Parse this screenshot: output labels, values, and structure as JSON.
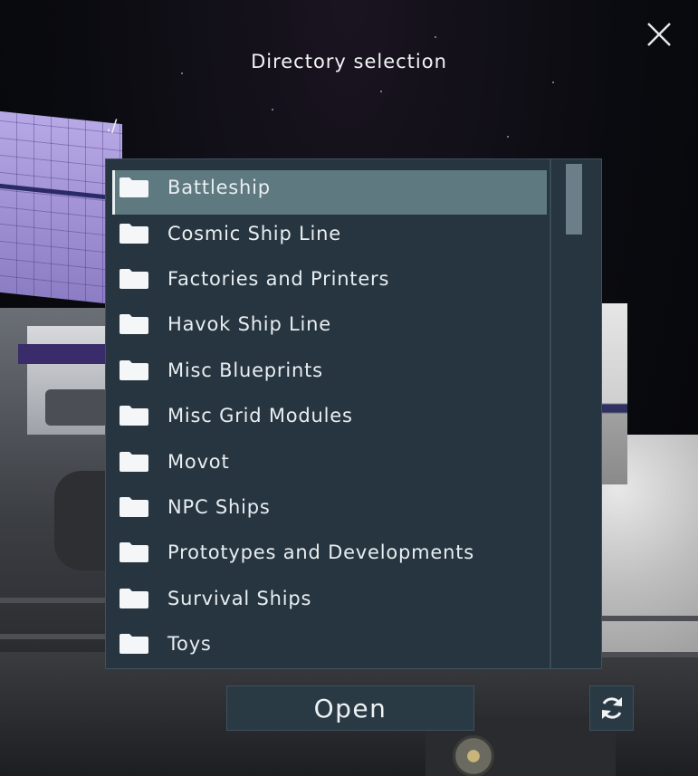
{
  "dialog": {
    "title": "Directory selection",
    "path": "./",
    "open_label": "Open"
  },
  "directories": [
    {
      "label": "Battleship",
      "selected": true
    },
    {
      "label": "Cosmic Ship Line",
      "selected": false
    },
    {
      "label": "Factories and Printers",
      "selected": false
    },
    {
      "label": "Havok Ship Line",
      "selected": false
    },
    {
      "label": "Misc Blueprints",
      "selected": false
    },
    {
      "label": "Misc Grid Modules",
      "selected": false
    },
    {
      "label": "Movot",
      "selected": false
    },
    {
      "label": "NPC Ships",
      "selected": false
    },
    {
      "label": "Prototypes and Developments",
      "selected": false
    },
    {
      "label": "Survival Ships",
      "selected": false
    },
    {
      "label": "Toys",
      "selected": false
    }
  ],
  "icons": {
    "close": "close-icon",
    "folder": "folder-icon",
    "refresh": "refresh-icon"
  },
  "colors": {
    "panel": "#263540",
    "selected_row": "#5f7980",
    "button": "#2a3a45",
    "text": "#e8eef1"
  }
}
